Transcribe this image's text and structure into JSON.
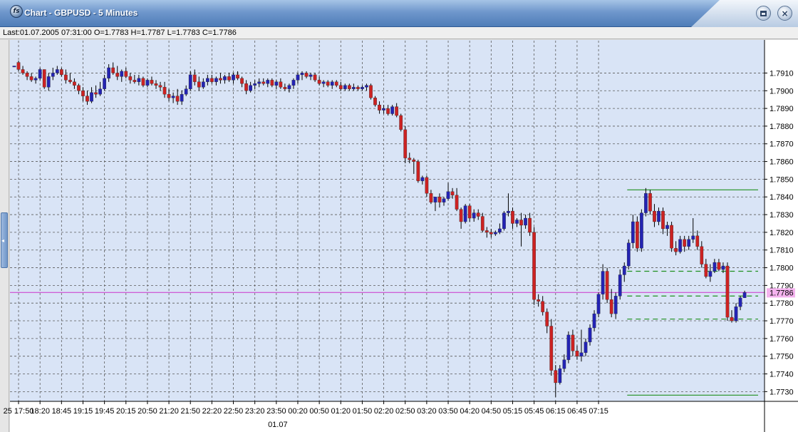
{
  "window": {
    "title": "Chart - GBPUSD - 5 Minutes",
    "icon": "fs-logo-icon",
    "restore_icon": "restore-icon",
    "close_icon": "close-icon",
    "close_glyph": "×"
  },
  "info": {
    "last_quote": "Last:01.07.2005 07:31:00 O=1.7783 H=1.7787 L=1.7783 C=1.7786"
  },
  "colors": {
    "background": "#d9e4f6",
    "grid": "#5a5a5a",
    "bull": "#2323b3",
    "bear": "#cc2222",
    "wick": "#000000",
    "level_line": "#1f8f1f",
    "last_price_line": "#cc33cc",
    "last_price_badge": "#f4b3ee"
  },
  "chart_data": {
    "type": "candlestick",
    "instrument": "GBPUSD",
    "timeframe": "5 Minutes",
    "x_tick_labels": [
      "25 17:50",
      "18:20",
      "18:45",
      "19:15",
      "19:45",
      "20:15",
      "20:50",
      "21:20",
      "21:50",
      "22:20",
      "22:50",
      "23:20",
      "23:50",
      "00:20",
      "00:50",
      "01:20",
      "01:50",
      "02:20",
      "02:50",
      "03:20",
      "03:50",
      "04:20",
      "04:50",
      "05:15",
      "05:45",
      "06:15",
      "06:45",
      "07:15"
    ],
    "date_marker": "01.07",
    "y_tick_labels": [
      "1.7910",
      "1.7900",
      "1.7890",
      "1.7880",
      "1.7870",
      "1.7860",
      "1.7850",
      "1.7840",
      "1.7830",
      "1.7820",
      "1.7810",
      "1.7800",
      "1.7790",
      "1.7780",
      "1.7770",
      "1.7760",
      "1.7750",
      "1.7740",
      "1.7730"
    ],
    "ylim": [
      1.77245,
      1.79283
    ],
    "grid": true,
    "last_price": "1.7786",
    "levels": [
      {
        "price": 1.7844,
        "style": "solid"
      },
      {
        "price": 1.7798,
        "style": "dashed"
      },
      {
        "price": 1.7784,
        "style": "dashed"
      },
      {
        "price": 1.7771,
        "style": "dashed"
      },
      {
        "price": 1.7728,
        "style": "solid"
      }
    ],
    "level_start_index": 143,
    "candles": [
      [
        1.7914,
        1.7914,
        1.7914,
        1.7914
      ],
      [
        1.7916,
        1.7917,
        1.7911,
        1.7912
      ],
      [
        1.7912,
        1.7914,
        1.7909,
        1.791
      ],
      [
        1.791,
        1.7911,
        1.7906,
        1.7908
      ],
      [
        1.7908,
        1.791,
        1.7905,
        1.7906
      ],
      [
        1.7906,
        1.7908,
        1.7904,
        1.7907
      ],
      [
        1.7907,
        1.7913,
        1.7906,
        1.7912
      ],
      [
        1.7912,
        1.7912,
        1.7901,
        1.7902
      ],
      [
        1.7902,
        1.791,
        1.79,
        1.7908
      ],
      [
        1.7908,
        1.7913,
        1.7906,
        1.791
      ],
      [
        1.791,
        1.7914,
        1.7909,
        1.7912
      ],
      [
        1.7912,
        1.7913,
        1.7908,
        1.7909
      ],
      [
        1.7909,
        1.7912,
        1.7904,
        1.7906
      ],
      [
        1.7906,
        1.791,
        1.7904,
        1.7905
      ],
      [
        1.7905,
        1.7907,
        1.7901,
        1.7903
      ],
      [
        1.7903,
        1.7904,
        1.7898,
        1.79
      ],
      [
        1.79,
        1.7902,
        1.7894,
        1.7897
      ],
      [
        1.7897,
        1.79,
        1.7892,
        1.7894
      ],
      [
        1.7894,
        1.7902,
        1.7893,
        1.7899
      ],
      [
        1.7899,
        1.7903,
        1.7896,
        1.7898
      ],
      [
        1.7898,
        1.7905,
        1.7897,
        1.7901
      ],
      [
        1.7901,
        1.7909,
        1.79,
        1.7907
      ],
      [
        1.7907,
        1.7915,
        1.7905,
        1.7913
      ],
      [
        1.7913,
        1.7916,
        1.7909,
        1.791
      ],
      [
        1.791,
        1.7914,
        1.7906,
        1.7908
      ],
      [
        1.7908,
        1.7912,
        1.7905,
        1.7911
      ],
      [
        1.7911,
        1.7913,
        1.7907,
        1.7908
      ],
      [
        1.7908,
        1.791,
        1.7904,
        1.7906
      ],
      [
        1.7906,
        1.7909,
        1.7904,
        1.7905
      ],
      [
        1.7905,
        1.7909,
        1.7903,
        1.7907
      ],
      [
        1.7907,
        1.7908,
        1.7902,
        1.7903
      ],
      [
        1.7903,
        1.7907,
        1.7902,
        1.7906
      ],
      [
        1.7906,
        1.7908,
        1.7903,
        1.7904
      ],
      [
        1.7904,
        1.7906,
        1.7901,
        1.7903
      ],
      [
        1.7903,
        1.7905,
        1.79,
        1.7902
      ],
      [
        1.7902,
        1.7905,
        1.7896,
        1.7898
      ],
      [
        1.7898,
        1.7901,
        1.7894,
        1.7896
      ],
      [
        1.7896,
        1.7899,
        1.7893,
        1.7897
      ],
      [
        1.7897,
        1.7901,
        1.7892,
        1.7894
      ],
      [
        1.7894,
        1.79,
        1.7892,
        1.7898
      ],
      [
        1.7898,
        1.7903,
        1.7897,
        1.7901
      ],
      [
        1.7901,
        1.7911,
        1.79,
        1.7909
      ],
      [
        1.7909,
        1.7912,
        1.7903,
        1.7905
      ],
      [
        1.7905,
        1.7908,
        1.79,
        1.7902
      ],
      [
        1.7902,
        1.7907,
        1.7901,
        1.7905
      ],
      [
        1.7905,
        1.7909,
        1.7903,
        1.7907
      ],
      [
        1.7907,
        1.7909,
        1.7904,
        1.7905
      ],
      [
        1.7905,
        1.7908,
        1.7903,
        1.7907
      ],
      [
        1.7907,
        1.791,
        1.7904,
        1.7906
      ],
      [
        1.7906,
        1.7909,
        1.7904,
        1.7908
      ],
      [
        1.7908,
        1.791,
        1.7905,
        1.7906
      ],
      [
        1.7906,
        1.791,
        1.7904,
        1.7909
      ],
      [
        1.7909,
        1.7911,
        1.7906,
        1.7907
      ],
      [
        1.7907,
        1.7908,
        1.7902,
        1.7904
      ],
      [
        1.7904,
        1.7906,
        1.7898,
        1.79
      ],
      [
        1.79,
        1.7905,
        1.7899,
        1.7903
      ],
      [
        1.7903,
        1.7906,
        1.7901,
        1.7904
      ],
      [
        1.7904,
        1.7907,
        1.7902,
        1.7905
      ],
      [
        1.7905,
        1.7907,
        1.7903,
        1.7904
      ],
      [
        1.7904,
        1.7907,
        1.7902,
        1.7906
      ],
      [
        1.7906,
        1.7907,
        1.7902,
        1.7903
      ],
      [
        1.7903,
        1.7906,
        1.7901,
        1.7905
      ],
      [
        1.7905,
        1.7907,
        1.7901,
        1.7902
      ],
      [
        1.7902,
        1.7904,
        1.79,
        1.7901
      ],
      [
        1.7901,
        1.7904,
        1.7899,
        1.7903
      ],
      [
        1.7903,
        1.7907,
        1.7901,
        1.7906
      ],
      [
        1.7906,
        1.791,
        1.7904,
        1.7909
      ],
      [
        1.7909,
        1.7911,
        1.7906,
        1.791
      ],
      [
        1.791,
        1.7911,
        1.7907,
        1.7908
      ],
      [
        1.7908,
        1.791,
        1.7906,
        1.7909
      ],
      [
        1.7909,
        1.791,
        1.7905,
        1.7906
      ],
      [
        1.7906,
        1.7908,
        1.7903,
        1.7904
      ],
      [
        1.7904,
        1.7906,
        1.7902,
        1.7905
      ],
      [
        1.7905,
        1.7906,
        1.7902,
        1.7903
      ],
      [
        1.7903,
        1.7906,
        1.7901,
        1.7905
      ],
      [
        1.7905,
        1.7906,
        1.7902,
        1.7903
      ],
      [
        1.7903,
        1.7905,
        1.79,
        1.7901
      ],
      [
        1.7901,
        1.7904,
        1.79,
        1.7903
      ],
      [
        1.7903,
        1.7904,
        1.79,
        1.7901
      ],
      [
        1.7901,
        1.7904,
        1.79,
        1.7902
      ],
      [
        1.7902,
        1.7903,
        1.79,
        1.7901
      ],
      [
        1.7901,
        1.7903,
        1.79,
        1.7902
      ],
      [
        1.7902,
        1.7904,
        1.79,
        1.7903
      ],
      [
        1.7903,
        1.7904,
        1.7895,
        1.7896
      ],
      [
        1.7896,
        1.7897,
        1.7891,
        1.7892
      ],
      [
        1.7892,
        1.7894,
        1.7887,
        1.7889
      ],
      [
        1.7889,
        1.7892,
        1.7887,
        1.789
      ],
      [
        1.789,
        1.7892,
        1.7886,
        1.7887
      ],
      [
        1.7887,
        1.7892,
        1.7886,
        1.7891
      ],
      [
        1.7891,
        1.7893,
        1.7885,
        1.7886
      ],
      [
        1.7886,
        1.7887,
        1.7877,
        1.7878
      ],
      [
        1.7878,
        1.788,
        1.7859,
        1.7862
      ],
      [
        1.7862,
        1.7865,
        1.7859,
        1.7861
      ],
      [
        1.7861,
        1.7862,
        1.7853,
        1.786
      ],
      [
        1.786,
        1.7861,
        1.7848,
        1.7849
      ],
      [
        1.7849,
        1.7852,
        1.7847,
        1.7851
      ],
      [
        1.7851,
        1.7852,
        1.784,
        1.7842
      ],
      [
        1.7842,
        1.7844,
        1.7836,
        1.7837
      ],
      [
        1.7837,
        1.7839,
        1.7832,
        1.784
      ],
      [
        1.784,
        1.7842,
        1.7834,
        1.7837
      ],
      [
        1.7837,
        1.784,
        1.7835,
        1.7839
      ],
      [
        1.7839,
        1.7848,
        1.7838,
        1.7843
      ],
      [
        1.7843,
        1.7845,
        1.7839,
        1.7841
      ],
      [
        1.7841,
        1.7845,
        1.7832,
        1.7833
      ],
      [
        1.7833,
        1.7834,
        1.7822,
        1.7826
      ],
      [
        1.7826,
        1.7836,
        1.7825,
        1.7835
      ],
      [
        1.7835,
        1.7836,
        1.7826,
        1.7828
      ],
      [
        1.7828,
        1.7833,
        1.7826,
        1.7831
      ],
      [
        1.7831,
        1.7833,
        1.7827,
        1.7829
      ],
      [
        1.7829,
        1.7831,
        1.782,
        1.7821
      ],
      [
        1.7821,
        1.7823,
        1.7817,
        1.782
      ],
      [
        1.782,
        1.7822,
        1.7817,
        1.7819
      ],
      [
        1.7819,
        1.7821,
        1.7818,
        1.782
      ],
      [
        1.782,
        1.7825,
        1.7819,
        1.7822
      ],
      [
        1.7822,
        1.7832,
        1.7821,
        1.7831
      ],
      [
        1.7831,
        1.7842,
        1.7829,
        1.7832
      ],
      [
        1.7832,
        1.7834,
        1.7822,
        1.7825
      ],
      [
        1.7825,
        1.7828,
        1.7823,
        1.7827
      ],
      [
        1.7827,
        1.7831,
        1.7812,
        1.7824
      ],
      [
        1.7824,
        1.783,
        1.7822,
        1.7828
      ],
      [
        1.7828,
        1.7831,
        1.7818,
        1.782
      ],
      [
        1.782,
        1.7823,
        1.7779,
        1.7782
      ],
      [
        1.7782,
        1.7785,
        1.7778,
        1.7781
      ],
      [
        1.7781,
        1.7784,
        1.7773,
        1.7775
      ],
      [
        1.7775,
        1.7777,
        1.7763,
        1.7767
      ],
      [
        1.7767,
        1.7771,
        1.7739,
        1.7742
      ],
      [
        1.7742,
        1.7745,
        1.7727,
        1.7735
      ],
      [
        1.7735,
        1.7745,
        1.7734,
        1.7743
      ],
      [
        1.7743,
        1.7751,
        1.7741,
        1.7748
      ],
      [
        1.7748,
        1.7764,
        1.7746,
        1.7762
      ],
      [
        1.7762,
        1.7765,
        1.775,
        1.7753
      ],
      [
        1.7753,
        1.7756,
        1.7748,
        1.775
      ],
      [
        1.775,
        1.7765,
        1.7747,
        1.7752
      ],
      [
        1.7752,
        1.776,
        1.775,
        1.7758
      ],
      [
        1.7758,
        1.7768,
        1.7756,
        1.7766
      ],
      [
        1.7766,
        1.7776,
        1.7764,
        1.7774
      ],
      [
        1.7774,
        1.7786,
        1.7772,
        1.7785
      ],
      [
        1.7785,
        1.7802,
        1.7782,
        1.7798
      ],
      [
        1.7798,
        1.78,
        1.778,
        1.7782
      ],
      [
        1.7782,
        1.7788,
        1.7772,
        1.7774
      ],
      [
        1.7774,
        1.7786,
        1.7771,
        1.7784
      ],
      [
        1.7784,
        1.7799,
        1.7782,
        1.7796
      ],
      [
        1.7796,
        1.7803,
        1.7792,
        1.7801
      ],
      [
        1.7801,
        1.7816,
        1.7799,
        1.7814
      ],
      [
        1.7814,
        1.783,
        1.7811,
        1.7826
      ],
      [
        1.7826,
        1.7829,
        1.7809,
        1.7811
      ],
      [
        1.7811,
        1.7833,
        1.7809,
        1.7831
      ],
      [
        1.7831,
        1.7845,
        1.7829,
        1.7842
      ],
      [
        1.7842,
        1.7844,
        1.783,
        1.7832
      ],
      [
        1.7832,
        1.7836,
        1.7823,
        1.7826
      ],
      [
        1.7826,
        1.7834,
        1.7824,
        1.7832
      ],
      [
        1.7832,
        1.7834,
        1.7819,
        1.7822
      ],
      [
        1.7822,
        1.7826,
        1.7818,
        1.7824
      ],
      [
        1.7824,
        1.7826,
        1.7809,
        1.7811
      ],
      [
        1.7811,
        1.7815,
        1.7807,
        1.7809
      ],
      [
        1.7809,
        1.7818,
        1.7808,
        1.7816
      ],
      [
        1.7816,
        1.7818,
        1.7809,
        1.7812
      ],
      [
        1.7812,
        1.7818,
        1.781,
        1.7816
      ],
      [
        1.7816,
        1.7828,
        1.7814,
        1.7818
      ],
      [
        1.7818,
        1.7821,
        1.781,
        1.7812
      ],
      [
        1.7812,
        1.7815,
        1.78,
        1.7802
      ],
      [
        1.7802,
        1.7805,
        1.7794,
        1.7795
      ],
      [
        1.7795,
        1.7802,
        1.7792,
        1.7798
      ],
      [
        1.7798,
        1.7805,
        1.7797,
        1.7803
      ],
      [
        1.7803,
        1.7805,
        1.7798,
        1.7799
      ],
      [
        1.7799,
        1.7803,
        1.7797,
        1.7801
      ],
      [
        1.7801,
        1.7803,
        1.777,
        1.7772
      ],
      [
        1.7772,
        1.7776,
        1.7769,
        1.777
      ],
      [
        1.777,
        1.778,
        1.7769,
        1.7778
      ],
      [
        1.7778,
        1.7784,
        1.7776,
        1.7783
      ],
      [
        1.7783,
        1.7787,
        1.7783,
        1.7786
      ]
    ]
  }
}
